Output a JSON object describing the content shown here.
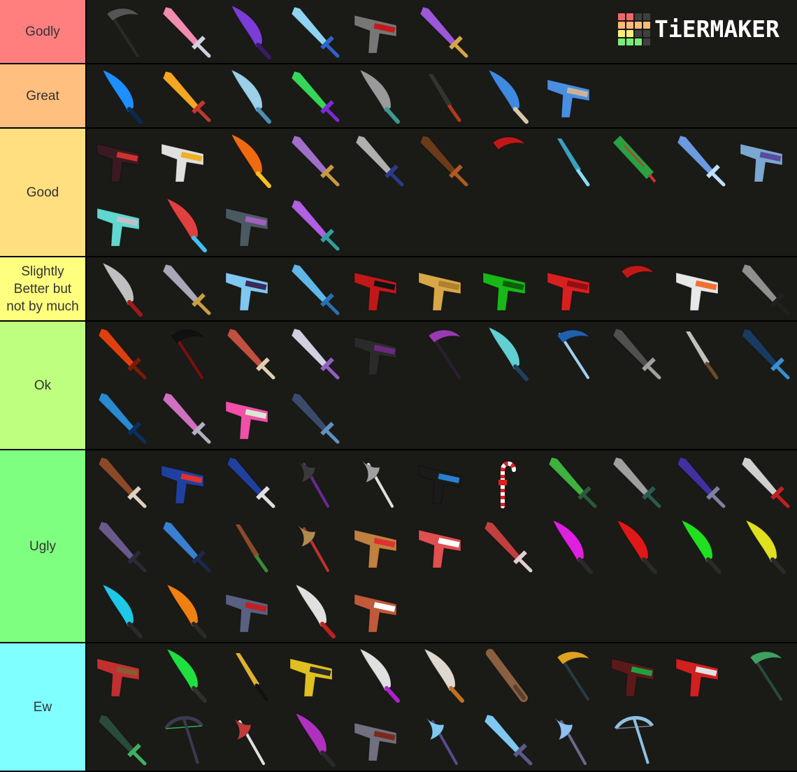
{
  "logo": {
    "text": "TiERMAKER",
    "grid": [
      [
        "#f0676b",
        "#f0676b",
        "#3f3f3f",
        "#3f3f3f"
      ],
      [
        "#ffbb77",
        "#ffbb77",
        "#ffbb77",
        "#ffbb77"
      ],
      [
        "#ffee77",
        "#ffee77",
        "#3f3f3f",
        "#3f3f3f"
      ],
      [
        "#77ee77",
        "#77ee77",
        "#77ee77",
        "#3f3f3f"
      ]
    ]
  },
  "tiers": [
    {
      "label": "Godly",
      "color": "#ff7f7f",
      "rows": 1,
      "items": [
        {
          "kind": "scythe",
          "c1": "#2a2a2a",
          "c2": "#555555"
        },
        {
          "kind": "sword",
          "c1": "#f28cb1",
          "c2": "#d0d0e0"
        },
        {
          "kind": "blade",
          "c1": "#7a3dd8",
          "c2": "#3a1a66"
        },
        {
          "kind": "sword",
          "c1": "#8fd3f0",
          "c2": "#2f63c8"
        },
        {
          "kind": "gun",
          "c1": "#777777",
          "c2": "#c41a1a"
        },
        {
          "kind": "sword",
          "c1": "#9b59d9",
          "c2": "#d4a64a"
        }
      ]
    },
    {
      "label": "Great",
      "color": "#ffbf7f",
      "rows": 1,
      "items": [
        {
          "kind": "blade",
          "c1": "#1d8fff",
          "c2": "#0a2a55"
        },
        {
          "kind": "sword",
          "c1": "#f5a623",
          "c2": "#c0392b"
        },
        {
          "kind": "blade",
          "c1": "#9ccfe8",
          "c2": "#4a90b8"
        },
        {
          "kind": "sword",
          "c1": "#36d65a",
          "c2": "#7b2bd6"
        },
        {
          "kind": "blade",
          "c1": "#9a9a9a",
          "c2": "#3a9a8f"
        },
        {
          "kind": "knife",
          "c1": "#333333",
          "c2": "#b03a1a"
        },
        {
          "kind": "blade",
          "c1": "#3e8ae0",
          "c2": "#d8c8a8"
        },
        {
          "kind": "gun",
          "c1": "#4a8ee0",
          "c2": "#c8b49a"
        }
      ]
    },
    {
      "label": "Good",
      "color": "#ffdf7f",
      "rows": 2,
      "items": [
        {
          "kind": "gun",
          "c1": "#3a1a22",
          "c2": "#d0312d"
        },
        {
          "kind": "gun",
          "c1": "#e0e0e0",
          "c2": "#f0b020"
        },
        {
          "kind": "blade",
          "c1": "#f06a10",
          "c2": "#f5c020"
        },
        {
          "kind": "sword",
          "c1": "#a070c8",
          "c2": "#c89a40"
        },
        {
          "kind": "sword",
          "c1": "#b0b0b0",
          "c2": "#2a3a8a"
        },
        {
          "kind": "sword",
          "c1": "#6b3a1a",
          "c2": "#b05a20"
        },
        {
          "kind": "scythe",
          "c1": "#1a1a1a",
          "c2": "#c01818"
        },
        {
          "kind": "knife",
          "c1": "#3aa0c0",
          "c2": "#8adcf0"
        },
        {
          "kind": "tree",
          "c1": "#2aa040",
          "c2": "#d03030"
        },
        {
          "kind": "sword",
          "c1": "#6a9ae0",
          "c2": "#c0e0ff"
        },
        {
          "kind": "gun",
          "c1": "#7aa8d0",
          "c2": "#5a4aa0"
        },
        {
          "kind": "gun",
          "c1": "#60d8d0",
          "c2": "#c0c0c8"
        },
        {
          "kind": "blade",
          "c1": "#e04040",
          "c2": "#40c0f0"
        },
        {
          "kind": "gun",
          "c1": "#4a5a60",
          "c2": "#a060c0"
        },
        {
          "kind": "sword",
          "c1": "#b060e0",
          "c2": "#30a0a0"
        }
      ]
    },
    {
      "label": "Slightly Better but not by much",
      "color": "#ffff7f",
      "rows": 1,
      "items": [
        {
          "kind": "blade",
          "c1": "#c0c0c0",
          "c2": "#a01818"
        },
        {
          "kind": "sword",
          "c1": "#a8a8b8",
          "c2": "#c8a040"
        },
        {
          "kind": "gun",
          "c1": "#80c8f0",
          "c2": "#3a2a5a"
        },
        {
          "kind": "sword",
          "c1": "#60b8e8",
          "c2": "#2a70b0"
        },
        {
          "kind": "gun",
          "c1": "#c01818",
          "c2": "#111111"
        },
        {
          "kind": "gun",
          "c1": "#d8a848",
          "c2": "#b08030"
        },
        {
          "kind": "gun",
          "c1": "#18b818",
          "c2": "#0a600a"
        },
        {
          "kind": "gun",
          "c1": "#d82020",
          "c2": "#901010"
        },
        {
          "kind": "scythe",
          "c1": "#1a1a1a",
          "c2": "#c01818"
        },
        {
          "kind": "gun",
          "c1": "#e8e8e8",
          "c2": "#f07030"
        },
        {
          "kind": "sword",
          "c1": "#909090",
          "c2": "#202020"
        }
      ]
    },
    {
      "label": "Ok",
      "color": "#bfff7f",
      "rows": 2,
      "items": [
        {
          "kind": "sword",
          "c1": "#e04010",
          "c2": "#7a1a0a"
        },
        {
          "kind": "scythe",
          "c1": "#7a1010",
          "c2": "#111111"
        },
        {
          "kind": "sword",
          "c1": "#c05040",
          "c2": "#e0d0b0"
        },
        {
          "kind": "sword",
          "c1": "#d0d0e0",
          "c2": "#9060c0"
        },
        {
          "kind": "gun",
          "c1": "#2a2a2a",
          "c2": "#6a2a80"
        },
        {
          "kind": "scythe",
          "c1": "#2a2030",
          "c2": "#9a3ab0"
        },
        {
          "kind": "blade",
          "c1": "#60d0d0",
          "c2": "#204060"
        },
        {
          "kind": "scythe",
          "c1": "#a0d0f0",
          "c2": "#2060b0"
        },
        {
          "kind": "sword",
          "c1": "#505050",
          "c2": "#a0a0a0"
        },
        {
          "kind": "knife",
          "c1": "#c0c0c0",
          "c2": "#6a4a2a"
        },
        {
          "kind": "sword",
          "c1": "#1a3a60",
          "c2": "#3a90d0"
        },
        {
          "kind": "sword",
          "c1": "#2a8ad0",
          "c2": "#0a3060"
        },
        {
          "kind": "sword",
          "c1": "#d070c0",
          "c2": "#b0b0c0"
        },
        {
          "kind": "gun",
          "c1": "#f050a8",
          "c2": "#d8e8d0"
        },
        {
          "kind": "sword",
          "c1": "#3a4a6a",
          "c2": "#6090c0"
        }
      ]
    },
    {
      "label": "Ugly",
      "color": "#7fff7f",
      "rows": 3,
      "items": [
        {
          "kind": "sword",
          "c1": "#8a4a2a",
          "c2": "#e0d0c0"
        },
        {
          "kind": "gun",
          "c1": "#2040a0",
          "c2": "#e03030"
        },
        {
          "kind": "sword",
          "c1": "#2040a0",
          "c2": "#e0e0e0"
        },
        {
          "kind": "axe",
          "c1": "#3a3a3a",
          "c2": "#6a2a90"
        },
        {
          "kind": "axe",
          "c1": "#a0a0a0",
          "c2": "#e0e0e0"
        },
        {
          "kind": "gun",
          "c1": "#1a1a1a",
          "c2": "#2a80d0"
        },
        {
          "kind": "cane",
          "c1": "#e02020",
          "c2": "#ffffff"
        },
        {
          "kind": "sword",
          "c1": "#40b040",
          "c2": "#2a5a3a"
        },
        {
          "kind": "sword",
          "c1": "#a0a0a0",
          "c2": "#2a5a50"
        },
        {
          "kind": "sword",
          "c1": "#4030a0",
          "c2": "#8080a0"
        },
        {
          "kind": "sword",
          "c1": "#d0d0d0",
          "c2": "#c02020"
        },
        {
          "kind": "sword",
          "c1": "#6a5a8a",
          "c2": "#2a2a3a"
        },
        {
          "kind": "sword",
          "c1": "#3a80d0",
          "c2": "#1a2a4a"
        },
        {
          "kind": "knife",
          "c1": "#8a4a2a",
          "c2": "#3a8a3a"
        },
        {
          "kind": "axe",
          "c1": "#b08a50",
          "c2": "#c03030"
        },
        {
          "kind": "gun",
          "c1": "#c08040",
          "c2": "#e03030"
        },
        {
          "kind": "gun",
          "c1": "#e05050",
          "c2": "#ffffff"
        },
        {
          "kind": "sword",
          "c1": "#c04040",
          "c2": "#e0d0d0"
        },
        {
          "kind": "blade",
          "c1": "#e020e0",
          "c2": "#2a2a2a"
        },
        {
          "kind": "blade",
          "c1": "#e01818",
          "c2": "#2a2a2a"
        },
        {
          "kind": "blade",
          "c1": "#20e020",
          "c2": "#2a2a2a"
        },
        {
          "kind": "blade",
          "c1": "#e0e020",
          "c2": "#2a2a2a"
        },
        {
          "kind": "blade",
          "c1": "#20c8e8",
          "c2": "#2a2a2a"
        },
        {
          "kind": "blade",
          "c1": "#f08010",
          "c2": "#2a2a2a"
        },
        {
          "kind": "gun",
          "c1": "#5a6080",
          "c2": "#c02020"
        },
        {
          "kind": "blade",
          "c1": "#e0e0e0",
          "c2": "#c02020"
        },
        {
          "kind": "gun",
          "c1": "#c05a3a",
          "c2": "#ffffff"
        }
      ]
    },
    {
      "label": "Ew",
      "color": "#7fffff",
      "rows": 2,
      "items": [
        {
          "kind": "gun",
          "c1": "#c03030",
          "c2": "#8a5a30"
        },
        {
          "kind": "blade",
          "c1": "#20e040",
          "c2": "#303030"
        },
        {
          "kind": "knife",
          "c1": "#e0b030",
          "c2": "#111111"
        },
        {
          "kind": "gun",
          "c1": "#e0c020",
          "c2": "#2a2a2a"
        },
        {
          "kind": "blade",
          "c1": "#e0e0e0",
          "c2": "#b020d0"
        },
        {
          "kind": "blade",
          "c1": "#e0d8d0",
          "c2": "#c07020"
        },
        {
          "kind": "bat",
          "c1": "#8a6040",
          "c2": "#5a4030"
        },
        {
          "kind": "scythe",
          "c1": "#2a3a40",
          "c2": "#e0a020"
        },
        {
          "kind": "gun",
          "c1": "#5a1a1a",
          "c2": "#20a040"
        },
        {
          "kind": "gun",
          "c1": "#d02020",
          "c2": "#e0e0e0"
        },
        {
          "kind": "scythe",
          "c1": "#2a4a3a",
          "c2": "#40a060"
        },
        {
          "kind": "sword",
          "c1": "#2a4a3a",
          "c2": "#40b060"
        },
        {
          "kind": "bow",
          "c1": "#3a3a50",
          "c2": "#30b050"
        },
        {
          "kind": "axe",
          "c1": "#c03a3a",
          "c2": "#e0e0e0"
        },
        {
          "kind": "blade",
          "c1": "#b030c0",
          "c2": "#2a2a2a"
        },
        {
          "kind": "gun",
          "c1": "#707080",
          "c2": "#7a2a1a"
        },
        {
          "kind": "axe",
          "c1": "#80c8f0",
          "c2": "#5a4a8a"
        },
        {
          "kind": "sword",
          "c1": "#80c8f0",
          "c2": "#5a5a8a"
        },
        {
          "kind": "axe",
          "c1": "#90c0f0",
          "c2": "#6a6a8a"
        },
        {
          "kind": "bow",
          "c1": "#90c0e0",
          "c2": "#7a7a9a"
        }
      ]
    }
  ]
}
